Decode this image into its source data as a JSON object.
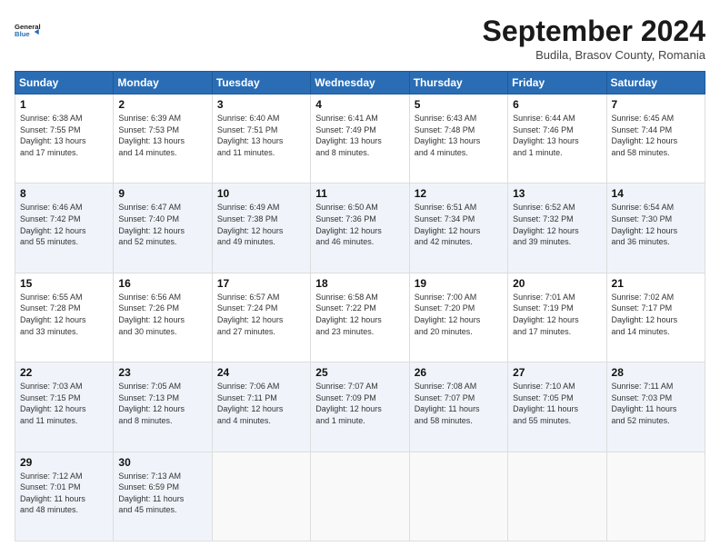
{
  "header": {
    "logo_line1": "General",
    "logo_line2": "Blue",
    "month": "September 2024",
    "location": "Budila, Brasov County, Romania"
  },
  "days_of_week": [
    "Sunday",
    "Monday",
    "Tuesday",
    "Wednesday",
    "Thursday",
    "Friday",
    "Saturday"
  ],
  "weeks": [
    [
      {
        "day": 1,
        "info": "Sunrise: 6:38 AM\nSunset: 7:55 PM\nDaylight: 13 hours\nand 17 minutes."
      },
      {
        "day": 2,
        "info": "Sunrise: 6:39 AM\nSunset: 7:53 PM\nDaylight: 13 hours\nand 14 minutes."
      },
      {
        "day": 3,
        "info": "Sunrise: 6:40 AM\nSunset: 7:51 PM\nDaylight: 13 hours\nand 11 minutes."
      },
      {
        "day": 4,
        "info": "Sunrise: 6:41 AM\nSunset: 7:49 PM\nDaylight: 13 hours\nand 8 minutes."
      },
      {
        "day": 5,
        "info": "Sunrise: 6:43 AM\nSunset: 7:48 PM\nDaylight: 13 hours\nand 4 minutes."
      },
      {
        "day": 6,
        "info": "Sunrise: 6:44 AM\nSunset: 7:46 PM\nDaylight: 13 hours\nand 1 minute."
      },
      {
        "day": 7,
        "info": "Sunrise: 6:45 AM\nSunset: 7:44 PM\nDaylight: 12 hours\nand 58 minutes."
      }
    ],
    [
      {
        "day": 8,
        "info": "Sunrise: 6:46 AM\nSunset: 7:42 PM\nDaylight: 12 hours\nand 55 minutes."
      },
      {
        "day": 9,
        "info": "Sunrise: 6:47 AM\nSunset: 7:40 PM\nDaylight: 12 hours\nand 52 minutes."
      },
      {
        "day": 10,
        "info": "Sunrise: 6:49 AM\nSunset: 7:38 PM\nDaylight: 12 hours\nand 49 minutes."
      },
      {
        "day": 11,
        "info": "Sunrise: 6:50 AM\nSunset: 7:36 PM\nDaylight: 12 hours\nand 46 minutes."
      },
      {
        "day": 12,
        "info": "Sunrise: 6:51 AM\nSunset: 7:34 PM\nDaylight: 12 hours\nand 42 minutes."
      },
      {
        "day": 13,
        "info": "Sunrise: 6:52 AM\nSunset: 7:32 PM\nDaylight: 12 hours\nand 39 minutes."
      },
      {
        "day": 14,
        "info": "Sunrise: 6:54 AM\nSunset: 7:30 PM\nDaylight: 12 hours\nand 36 minutes."
      }
    ],
    [
      {
        "day": 15,
        "info": "Sunrise: 6:55 AM\nSunset: 7:28 PM\nDaylight: 12 hours\nand 33 minutes."
      },
      {
        "day": 16,
        "info": "Sunrise: 6:56 AM\nSunset: 7:26 PM\nDaylight: 12 hours\nand 30 minutes."
      },
      {
        "day": 17,
        "info": "Sunrise: 6:57 AM\nSunset: 7:24 PM\nDaylight: 12 hours\nand 27 minutes."
      },
      {
        "day": 18,
        "info": "Sunrise: 6:58 AM\nSunset: 7:22 PM\nDaylight: 12 hours\nand 23 minutes."
      },
      {
        "day": 19,
        "info": "Sunrise: 7:00 AM\nSunset: 7:20 PM\nDaylight: 12 hours\nand 20 minutes."
      },
      {
        "day": 20,
        "info": "Sunrise: 7:01 AM\nSunset: 7:19 PM\nDaylight: 12 hours\nand 17 minutes."
      },
      {
        "day": 21,
        "info": "Sunrise: 7:02 AM\nSunset: 7:17 PM\nDaylight: 12 hours\nand 14 minutes."
      }
    ],
    [
      {
        "day": 22,
        "info": "Sunrise: 7:03 AM\nSunset: 7:15 PM\nDaylight: 12 hours\nand 11 minutes."
      },
      {
        "day": 23,
        "info": "Sunrise: 7:05 AM\nSunset: 7:13 PM\nDaylight: 12 hours\nand 8 minutes."
      },
      {
        "day": 24,
        "info": "Sunrise: 7:06 AM\nSunset: 7:11 PM\nDaylight: 12 hours\nand 4 minutes."
      },
      {
        "day": 25,
        "info": "Sunrise: 7:07 AM\nSunset: 7:09 PM\nDaylight: 12 hours\nand 1 minute."
      },
      {
        "day": 26,
        "info": "Sunrise: 7:08 AM\nSunset: 7:07 PM\nDaylight: 11 hours\nand 58 minutes."
      },
      {
        "day": 27,
        "info": "Sunrise: 7:10 AM\nSunset: 7:05 PM\nDaylight: 11 hours\nand 55 minutes."
      },
      {
        "day": 28,
        "info": "Sunrise: 7:11 AM\nSunset: 7:03 PM\nDaylight: 11 hours\nand 52 minutes."
      }
    ],
    [
      {
        "day": 29,
        "info": "Sunrise: 7:12 AM\nSunset: 7:01 PM\nDaylight: 11 hours\nand 48 minutes."
      },
      {
        "day": 30,
        "info": "Sunrise: 7:13 AM\nSunset: 6:59 PM\nDaylight: 11 hours\nand 45 minutes."
      },
      null,
      null,
      null,
      null,
      null
    ]
  ]
}
